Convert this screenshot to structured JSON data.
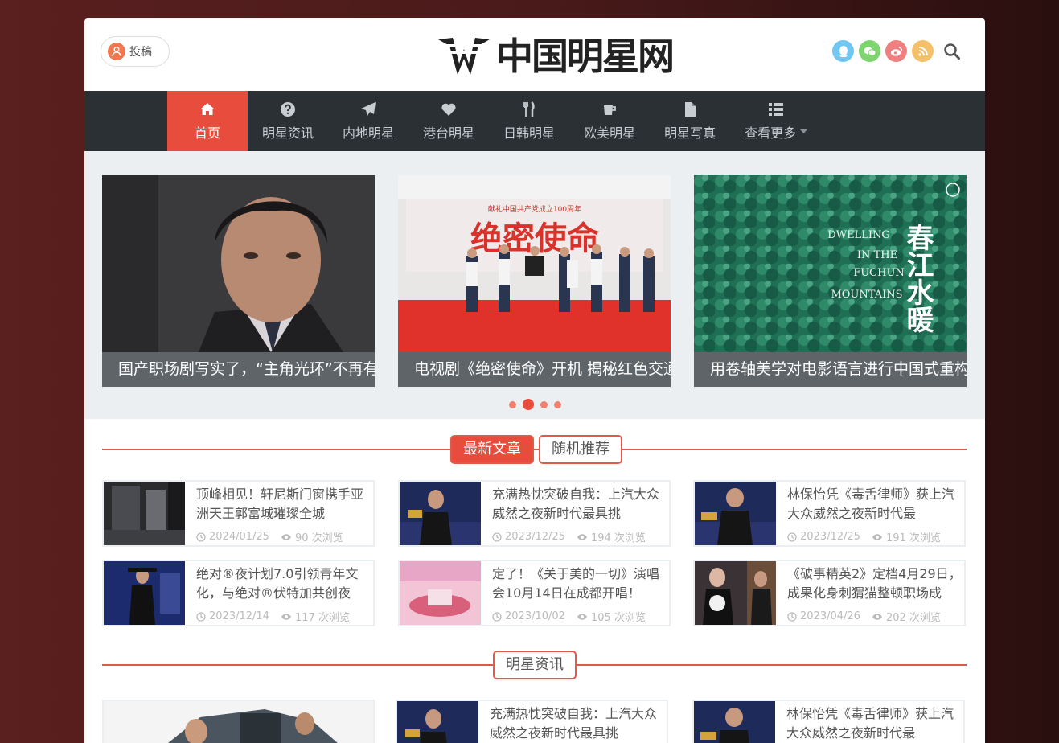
{
  "header": {
    "submit_label": "投稿",
    "logo_text": "中国明星网",
    "social_icons": [
      {
        "name": "qq-icon",
        "color": "#6fc7f2"
      },
      {
        "name": "wechat-icon",
        "color": "#7ed46f"
      },
      {
        "name": "weibo-icon",
        "color": "#f07f7f"
      },
      {
        "name": "rss-icon",
        "color": "#f5c06a"
      }
    ]
  },
  "nav": {
    "items": [
      {
        "label": "首页",
        "icon": "home-icon",
        "active": true
      },
      {
        "label": "明星资讯",
        "icon": "question-icon"
      },
      {
        "label": "内地明星",
        "icon": "paper-plane-icon"
      },
      {
        "label": "港台明星",
        "icon": "heart-icon"
      },
      {
        "label": "日韩明星",
        "icon": "cutlery-icon"
      },
      {
        "label": "欧美明星",
        "icon": "coffee-icon"
      },
      {
        "label": "明星写真",
        "icon": "file-icon"
      },
      {
        "label": "查看更多",
        "icon": "list-icon"
      }
    ]
  },
  "slider": {
    "slides": [
      {
        "caption": "国产职场剧写实了，“主角光环”不再有"
      },
      {
        "caption": "电视剧《绝密使命》开机 揭秘红色交通线"
      },
      {
        "caption": "用卷轴美学对电影语言进行中国式重构"
      }
    ],
    "slide_texts": {
      "banner": "绝密使命",
      "banner_top": "献礼中国共产党成立100周年",
      "poster_title_cn": "春江水暖",
      "poster_en_1": "DWELLING",
      "poster_en_2": "IN THE",
      "poster_en_3": "FUCHUN",
      "poster_en_4": "MOUNTAINS"
    },
    "active_dot": 1
  },
  "latest": {
    "tabs": [
      "最新文章",
      "随机推荐"
    ],
    "articles": [
      {
        "title": "顶峰相见！轩尼斯门窗携手亚洲天王郭富城璀璨全城",
        "date": "2024/01/25",
        "views": "90 次浏览"
      },
      {
        "title": "充满热忱突破自我：上汽大众威然之夜新时代最具挑",
        "date": "2023/12/25",
        "views": "194 次浏览"
      },
      {
        "title": "林保怡凭《毒舌律师》获上汽大众威然之夜新时代最",
        "date": "2023/12/25",
        "views": "191 次浏览"
      },
      {
        "title": "绝对®夜计划7.0引领青年文化，与绝对®伏特加共创夜",
        "date": "2023/12/14",
        "views": "117 次浏览"
      },
      {
        "title": "定了！《关于美的一切》演唱会10月14日在成都开唱！",
        "date": "2023/10/02",
        "views": "105 次浏览"
      },
      {
        "title": "《破事精英2》定档4月29日，成果化身刺猬猫整顿职场成",
        "date": "2023/04/26",
        "views": "202 次浏览"
      }
    ]
  },
  "news": {
    "heading": "明星资讯",
    "articles": [
      {
        "title": "充满热忱突破自我：上汽大众威然之夜新时代最具挑"
      },
      {
        "title": "林保怡凭《毒舌律师》获上汽大众威然之夜新时代最"
      }
    ]
  },
  "colors": {
    "accent": "#e74c3c",
    "nav_bg": "#2b3035"
  }
}
